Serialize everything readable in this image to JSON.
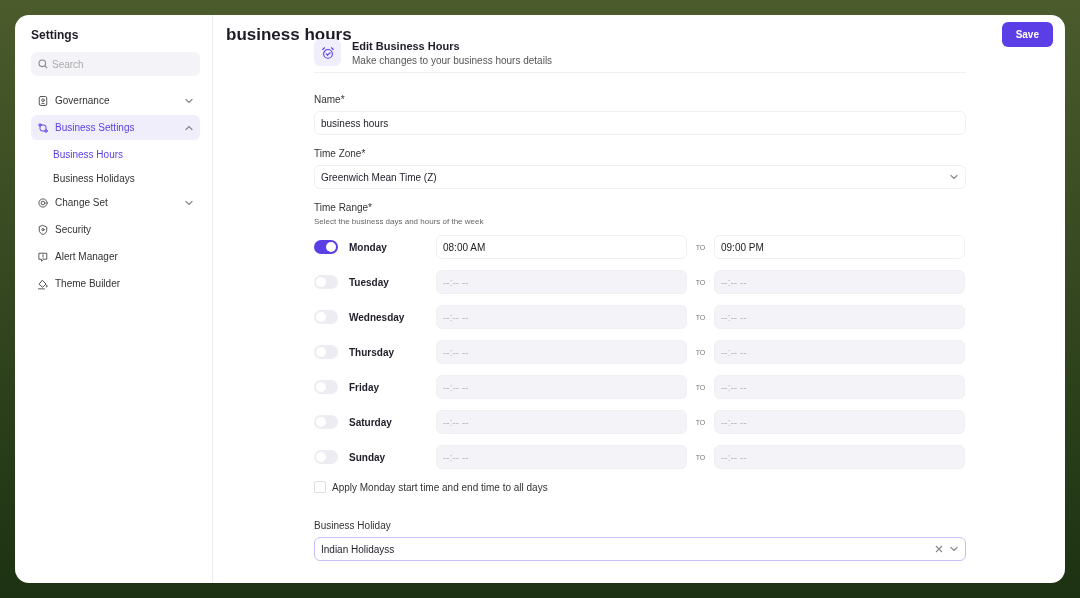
{
  "sidebar": {
    "title": "Settings",
    "search": {
      "placeholder": "Search"
    },
    "items": [
      {
        "label": "Governance",
        "kind": "badge",
        "expanded": false,
        "selected": false
      },
      {
        "label": "Business Settings",
        "kind": "route",
        "expanded": true,
        "selected": true,
        "children": [
          {
            "label": "Business Hours",
            "selected": true
          },
          {
            "label": "Business Holidays",
            "selected": false
          }
        ]
      },
      {
        "label": "Change Set",
        "kind": "target",
        "expanded": false,
        "selected": false
      },
      {
        "label": "Security",
        "kind": "shield",
        "selected": false
      },
      {
        "label": "Alert Manager",
        "kind": "alert",
        "selected": false
      },
      {
        "label": "Theme Builder",
        "kind": "bucket",
        "selected": false
      }
    ]
  },
  "page": {
    "title": "business hours",
    "save": "Save"
  },
  "form": {
    "heading": "Edit Business Hours",
    "subheading": "Make changes to your business hours details",
    "name": {
      "label": "Name*",
      "value": "business hours"
    },
    "time_zone": {
      "label": "Time Zone*",
      "value": "Greenwich Mean Time (Z)"
    },
    "time_range": {
      "label": "Time Range*",
      "hint": "Select the business days and hours of the week"
    },
    "days": [
      {
        "day": "Monday",
        "on": true,
        "start": {
          "value": "08:00 AM"
        },
        "to": "TO",
        "end": {
          "value": "09:00 PM"
        }
      },
      {
        "day": "Tuesday",
        "on": false,
        "start": {
          "placeholder": "--:-- --"
        },
        "to": "TO",
        "end": {
          "placeholder": "--:-- --"
        }
      },
      {
        "day": "Wednesday",
        "on": false,
        "start": {
          "placeholder": "--:-- --"
        },
        "to": "TO",
        "end": {
          "placeholder": "--:-- --"
        }
      },
      {
        "day": "Thursday",
        "on": false,
        "start": {
          "placeholder": "--:-- --"
        },
        "to": "TO",
        "end": {
          "placeholder": "--:-- --"
        }
      },
      {
        "day": "Friday",
        "on": false,
        "start": {
          "placeholder": "--:-- --"
        },
        "to": "TO",
        "end": {
          "placeholder": "--:-- --"
        }
      },
      {
        "day": "Saturday",
        "on": false,
        "start": {
          "placeholder": "--:-- --"
        },
        "to": "TO",
        "end": {
          "placeholder": "--:-- --"
        }
      },
      {
        "day": "Sunday",
        "on": false,
        "start": {
          "placeholder": "--:-- --"
        },
        "to": "TO",
        "end": {
          "placeholder": "--:-- --"
        }
      }
    ],
    "apply_all": {
      "label": "Apply Monday start time and end time to all days",
      "checked": false
    },
    "holiday": {
      "label": "Business Holiday",
      "value": "Indian Holidayss",
      "focused": true
    }
  }
}
